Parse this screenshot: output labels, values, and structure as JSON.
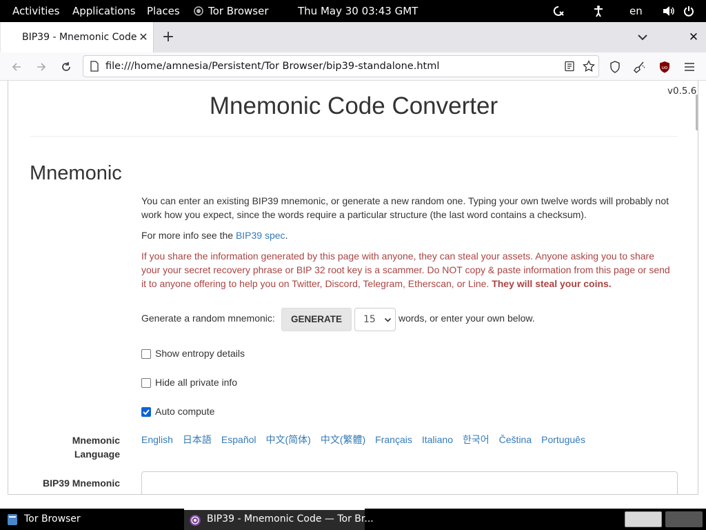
{
  "topbar": {
    "activities": "Activities",
    "applications": "Applications",
    "places": "Places",
    "tor_browser": "Tor Browser",
    "datetime": "Thu May 30  03:43 GMT",
    "lang": "en"
  },
  "tabs": [
    {
      "title": "BIP39 - Mnemonic Code"
    }
  ],
  "navbar": {
    "url": "file:///home/amnesia/Persistent/Tor Browser/bip39-standalone.html"
  },
  "page": {
    "version": "v0.5.6",
    "title": "Mnemonic Code Converter",
    "section_title": "Mnemonic",
    "intro": "You can enter an existing BIP39 mnemonic, or generate a new random one. Typing your own twelve words will probably not work how you expect, since the words require a particular structure (the last word contains a checksum).",
    "more_info_prefix": "For more info see the ",
    "more_info_link": "BIP39 spec",
    "more_info_suffix": ".",
    "warning": "If you share the information generated by this page with anyone, they can steal your assets. Anyone asking you to share your your secret recovery phrase or BIP 32 root key is a scammer. Do NOT copy & paste information from this page or send it to anyone offering to help you on Twitter, Discord, Telegram, Etherscan, or Line. ",
    "warning_bold": "They will steal your coins.",
    "generate_prefix": "Generate a random mnemonic:",
    "generate_button": "GENERATE",
    "word_count": "15",
    "generate_suffix": "words, or enter your own below.",
    "show_entropy": "Show entropy details",
    "hide_private": "Hide all private info",
    "auto_compute": "Auto compute",
    "auto_compute_checked": true,
    "language_label_1": "Mnemonic",
    "language_label_2": "Language",
    "languages": [
      "English",
      "日本語",
      "Español",
      "中文(简体)",
      "中文(繁體)",
      "Français",
      "Italiano",
      "한국어",
      "Čeština",
      "Português"
    ],
    "bip39_label": "BIP39 Mnemonic"
  },
  "taskbar": {
    "app": "Tor Browser",
    "window": "BIP39 - Mnemonic Code — Tor Br..."
  }
}
